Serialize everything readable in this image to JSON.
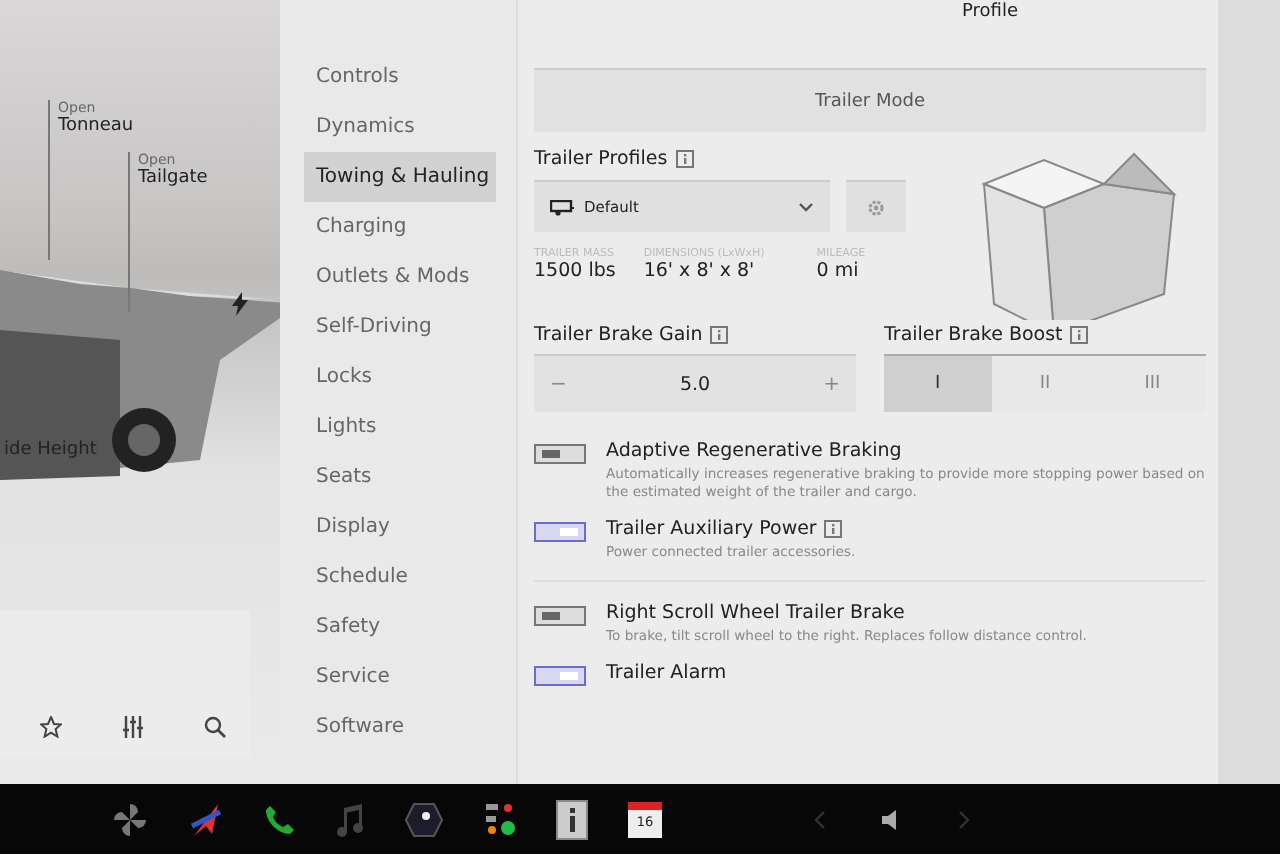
{
  "car_view": {
    "callouts": [
      {
        "caption": "Open",
        "name": "Tonneau"
      },
      {
        "caption": "Open",
        "name": "Tailgate"
      }
    ],
    "ride_height": "ide Height"
  },
  "header": {
    "profile": "Profile"
  },
  "nav": {
    "items": [
      {
        "label": "Controls",
        "selected": false
      },
      {
        "label": "Dynamics",
        "selected": false
      },
      {
        "label": "Towing & Hauling",
        "selected": true
      },
      {
        "label": "Charging",
        "selected": false
      },
      {
        "label": "Outlets & Mods",
        "selected": false
      },
      {
        "label": "Self-Driving",
        "selected": false
      },
      {
        "label": "Locks",
        "selected": false
      },
      {
        "label": "Lights",
        "selected": false
      },
      {
        "label": "Seats",
        "selected": false
      },
      {
        "label": "Display",
        "selected": false
      },
      {
        "label": "Schedule",
        "selected": false
      },
      {
        "label": "Safety",
        "selected": false
      },
      {
        "label": "Service",
        "selected": false
      },
      {
        "label": "Software",
        "selected": false
      }
    ]
  },
  "trailer_mode": {
    "label": "Trailer Mode"
  },
  "profiles": {
    "title": "Trailer Profiles",
    "value": "Default"
  },
  "stats": [
    {
      "label": "TRAILER MASS",
      "value": "1500 lbs"
    },
    {
      "label": "DIMENSIONS (LxWxH)",
      "value": "16' x 8' x 8'"
    },
    {
      "label": "MILEAGE",
      "value": "0 mi"
    }
  ],
  "brake_gain": {
    "title": "Trailer Brake Gain",
    "minus": "−",
    "value": "5.0",
    "plus": "+"
  },
  "brake_boost": {
    "title": "Trailer Brake Boost",
    "options": [
      {
        "label": "I",
        "selected": true
      },
      {
        "label": "II",
        "selected": false
      },
      {
        "label": "III",
        "selected": false
      }
    ]
  },
  "toggle_groups": [
    [
      {
        "title": "Adaptive Regenerative Braking",
        "description": "Automatically increases regenerative braking to provide more stopping power based on the estimated weight of the trailer and cargo.",
        "on": false,
        "info": false
      },
      {
        "title": "Trailer Auxiliary Power",
        "description": "Power connected trailer accessories.",
        "on": true,
        "info": true
      }
    ],
    [
      {
        "title": "Right Scroll Wheel Trailer Brake",
        "description": "To brake, tilt scroll wheel to the right. Replaces follow distance control.",
        "on": false,
        "info": false
      },
      {
        "title": "Trailer Alarm",
        "on": true,
        "info": false
      }
    ]
  ],
  "taskbar": {
    "calendar_day": "16"
  }
}
